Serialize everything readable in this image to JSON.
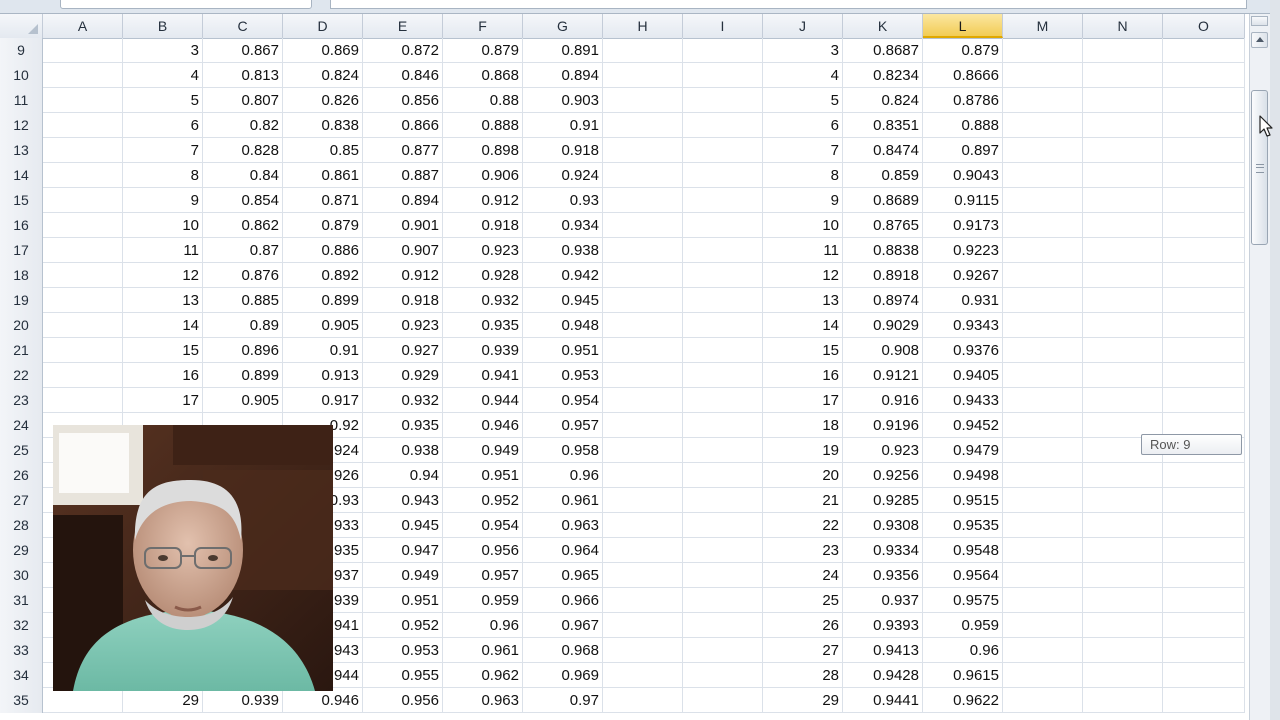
{
  "window": {
    "name_box_value": "",
    "formula_value": ""
  },
  "columns": [
    {
      "letter": "A",
      "selected": false
    },
    {
      "letter": "B",
      "selected": false
    },
    {
      "letter": "C",
      "selected": false
    },
    {
      "letter": "D",
      "selected": false
    },
    {
      "letter": "E",
      "selected": false
    },
    {
      "letter": "F",
      "selected": false
    },
    {
      "letter": "G",
      "selected": false
    },
    {
      "letter": "H",
      "selected": false
    },
    {
      "letter": "I",
      "selected": false
    },
    {
      "letter": "J",
      "selected": false
    },
    {
      "letter": "K",
      "selected": false
    },
    {
      "letter": "L",
      "selected": true
    },
    {
      "letter": "M",
      "selected": false
    },
    {
      "letter": "N",
      "selected": false
    },
    {
      "letter": "O",
      "selected": false
    }
  ],
  "rows": [
    {
      "num": "9",
      "cells": [
        "",
        "3",
        "0.867",
        "0.869",
        "0.872",
        "0.879",
        "0.891",
        "",
        "",
        "3",
        "0.8687",
        "0.879",
        "",
        "",
        ""
      ]
    },
    {
      "num": "10",
      "cells": [
        "",
        "4",
        "0.813",
        "0.824",
        "0.846",
        "0.868",
        "0.894",
        "",
        "",
        "4",
        "0.8234",
        "0.8666",
        "",
        "",
        ""
      ]
    },
    {
      "num": "11",
      "cells": [
        "",
        "5",
        "0.807",
        "0.826",
        "0.856",
        "0.88",
        "0.903",
        "",
        "",
        "5",
        "0.824",
        "0.8786",
        "",
        "",
        ""
      ]
    },
    {
      "num": "12",
      "cells": [
        "",
        "6",
        "0.82",
        "0.838",
        "0.866",
        "0.888",
        "0.91",
        "",
        "",
        "6",
        "0.8351",
        "0.888",
        "",
        "",
        ""
      ]
    },
    {
      "num": "13",
      "cells": [
        "",
        "7",
        "0.828",
        "0.85",
        "0.877",
        "0.898",
        "0.918",
        "",
        "",
        "7",
        "0.8474",
        "0.897",
        "",
        "",
        ""
      ]
    },
    {
      "num": "14",
      "cells": [
        "",
        "8",
        "0.84",
        "0.861",
        "0.887",
        "0.906",
        "0.924",
        "",
        "",
        "8",
        "0.859",
        "0.9043",
        "",
        "",
        ""
      ]
    },
    {
      "num": "15",
      "cells": [
        "",
        "9",
        "0.854",
        "0.871",
        "0.894",
        "0.912",
        "0.93",
        "",
        "",
        "9",
        "0.8689",
        "0.9115",
        "",
        "",
        ""
      ]
    },
    {
      "num": "16",
      "cells": [
        "",
        "10",
        "0.862",
        "0.879",
        "0.901",
        "0.918",
        "0.934",
        "",
        "",
        "10",
        "0.8765",
        "0.9173",
        "",
        "",
        ""
      ]
    },
    {
      "num": "17",
      "cells": [
        "",
        "11",
        "0.87",
        "0.886",
        "0.907",
        "0.923",
        "0.938",
        "",
        "",
        "11",
        "0.8838",
        "0.9223",
        "",
        "",
        ""
      ]
    },
    {
      "num": "18",
      "cells": [
        "",
        "12",
        "0.876",
        "0.892",
        "0.912",
        "0.928",
        "0.942",
        "",
        "",
        "12",
        "0.8918",
        "0.9267",
        "",
        "",
        ""
      ]
    },
    {
      "num": "19",
      "cells": [
        "",
        "13",
        "0.885",
        "0.899",
        "0.918",
        "0.932",
        "0.945",
        "",
        "",
        "13",
        "0.8974",
        "0.931",
        "",
        "",
        ""
      ]
    },
    {
      "num": "20",
      "cells": [
        "",
        "14",
        "0.89",
        "0.905",
        "0.923",
        "0.935",
        "0.948",
        "",
        "",
        "14",
        "0.9029",
        "0.9343",
        "",
        "",
        ""
      ]
    },
    {
      "num": "21",
      "cells": [
        "",
        "15",
        "0.896",
        "0.91",
        "0.927",
        "0.939",
        "0.951",
        "",
        "",
        "15",
        "0.908",
        "0.9376",
        "",
        "",
        ""
      ]
    },
    {
      "num": "22",
      "cells": [
        "",
        "16",
        "0.899",
        "0.913",
        "0.929",
        "0.941",
        "0.953",
        "",
        "",
        "16",
        "0.9121",
        "0.9405",
        "",
        "",
        ""
      ]
    },
    {
      "num": "23",
      "cells": [
        "",
        "17",
        "0.905",
        "0.917",
        "0.932",
        "0.944",
        "0.954",
        "",
        "",
        "17",
        "0.916",
        "0.9433",
        "",
        "",
        ""
      ]
    },
    {
      "num": "24",
      "cells": [
        "",
        "",
        "",
        "0.92",
        "0.935",
        "0.946",
        "0.957",
        "",
        "",
        "18",
        "0.9196",
        "0.9452",
        "",
        "",
        ""
      ]
    },
    {
      "num": "25",
      "cells": [
        "",
        "",
        "",
        "0.924",
        "0.938",
        "0.949",
        "0.958",
        "",
        "",
        "19",
        "0.923",
        "0.9479",
        "",
        "",
        ""
      ]
    },
    {
      "num": "26",
      "cells": [
        "",
        "",
        "",
        "0.926",
        "0.94",
        "0.951",
        "0.96",
        "",
        "",
        "20",
        "0.9256",
        "0.9498",
        "",
        "",
        ""
      ]
    },
    {
      "num": "27",
      "cells": [
        "",
        "",
        "",
        "0.93",
        "0.943",
        "0.952",
        "0.961",
        "",
        "",
        "21",
        "0.9285",
        "0.9515",
        "",
        "",
        ""
      ]
    },
    {
      "num": "28",
      "cells": [
        "",
        "",
        "",
        "0.933",
        "0.945",
        "0.954",
        "0.963",
        "",
        "",
        "22",
        "0.9308",
        "0.9535",
        "",
        "",
        ""
      ]
    },
    {
      "num": "29",
      "cells": [
        "",
        "",
        "",
        "0.935",
        "0.947",
        "0.956",
        "0.964",
        "",
        "",
        "23",
        "0.9334",
        "0.9548",
        "",
        "",
        ""
      ]
    },
    {
      "num": "30",
      "cells": [
        "",
        "",
        "",
        "0.937",
        "0.949",
        "0.957",
        "0.965",
        "",
        "",
        "24",
        "0.9356",
        "0.9564",
        "",
        "",
        ""
      ]
    },
    {
      "num": "31",
      "cells": [
        "",
        "",
        "",
        "0.939",
        "0.951",
        "0.959",
        "0.966",
        "",
        "",
        "25",
        "0.937",
        "0.9575",
        "",
        "",
        ""
      ]
    },
    {
      "num": "32",
      "cells": [
        "",
        "",
        "",
        "0.941",
        "0.952",
        "0.96",
        "0.967",
        "",
        "",
        "26",
        "0.9393",
        "0.959",
        "",
        "",
        ""
      ]
    },
    {
      "num": "33",
      "cells": [
        "",
        "",
        "",
        "0.943",
        "0.953",
        "0.961",
        "0.968",
        "",
        "",
        "27",
        "0.9413",
        "0.96",
        "",
        "",
        ""
      ]
    },
    {
      "num": "34",
      "cells": [
        "",
        "",
        "",
        "0.944",
        "0.955",
        "0.962",
        "0.969",
        "",
        "",
        "28",
        "0.9428",
        "0.9615",
        "",
        "",
        ""
      ]
    },
    {
      "num": "35",
      "cells": [
        "",
        "29",
        "0.939",
        "0.946",
        "0.956",
        "0.963",
        "0.97",
        "",
        "",
        "29",
        "0.9441",
        "0.9622",
        "",
        "",
        ""
      ]
    }
  ],
  "tooltip": {
    "text": "Row: 9"
  },
  "colors": {
    "grid_line": "#dbe1e9",
    "header_bg": "#e6eaf0",
    "selected_header": "#f2cc55"
  }
}
